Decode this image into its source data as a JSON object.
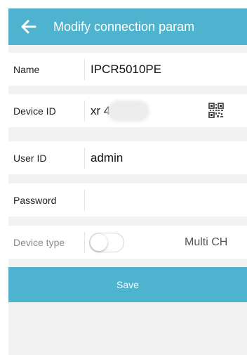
{
  "header": {
    "title": "Modify connection param",
    "back_icon": "arrow-left-icon",
    "color": "#4eb3cf"
  },
  "form": {
    "name": {
      "label": "Name",
      "value": "IPCR5010PE"
    },
    "device_id": {
      "label": "Device ID",
      "value": "xr       4dfu",
      "qr_icon": "qr-code-icon"
    },
    "user_id": {
      "label": "User ID",
      "value": "admin"
    },
    "password": {
      "label": "Password",
      "value": ""
    },
    "device_type": {
      "label": "Device type",
      "option_label": "Multi CH",
      "toggle_on": false
    }
  },
  "save_button": {
    "label": "Save"
  }
}
